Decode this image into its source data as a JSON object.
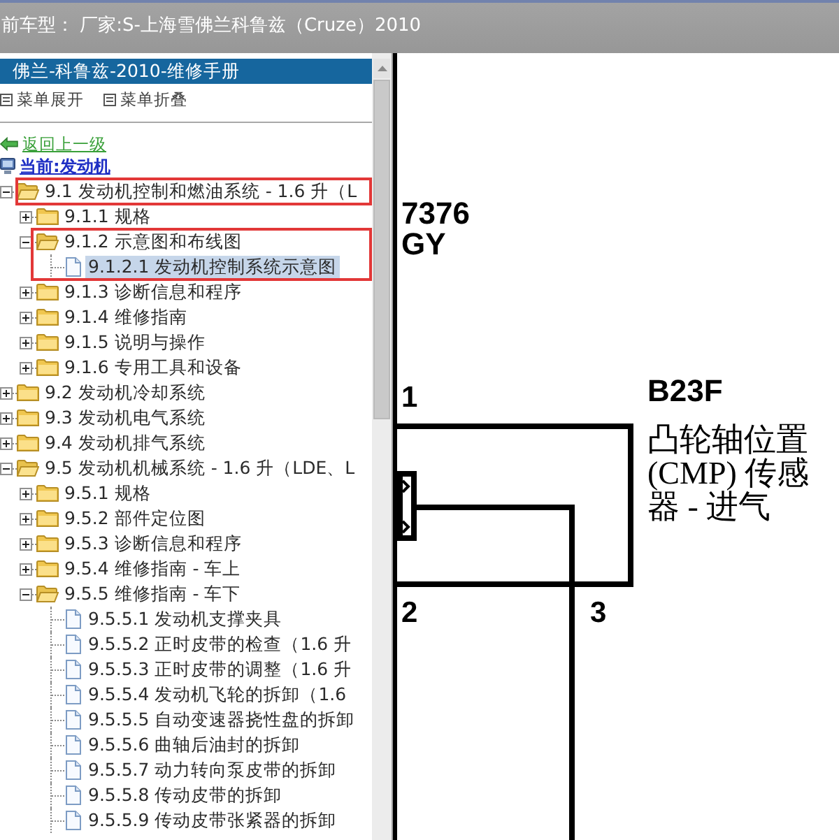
{
  "top_bar": {
    "text": "前车型： 厂家:S-上海雪佛兰科鲁兹（Cruze）2010"
  },
  "manual_panel": {
    "title": "佛兰-科鲁兹-2010-维修手册",
    "toolbar": [
      {
        "label": "菜单展开"
      },
      {
        "label": "菜单折叠"
      }
    ],
    "back_link": "返回上一级",
    "current_location": "当前:发动机",
    "tree": [
      {
        "kind": "folder",
        "label": "9.1 发动机控制和燃油系统 - 1.6 升（L",
        "expanded": true,
        "selected": false,
        "highlighted": true,
        "children": [
          {
            "kind": "folder",
            "label": "9.1.1 规格",
            "expanded": false,
            "selected": false,
            "highlighted": false
          },
          {
            "kind": "folder",
            "label": "9.1.2 示意图和布线图",
            "expanded": true,
            "selected": false,
            "highlighted": true,
            "children": [
              {
                "kind": "page",
                "label": "9.1.2.1 发动机控制系统示意图",
                "selected": true,
                "highlighted": true
              }
            ]
          },
          {
            "kind": "folder",
            "label": "9.1.3 诊断信息和程序",
            "expanded": false,
            "selected": false,
            "highlighted": false
          },
          {
            "kind": "folder",
            "label": "9.1.4 维修指南",
            "expanded": false,
            "selected": false,
            "highlighted": false
          },
          {
            "kind": "folder",
            "label": "9.1.5 说明与操作",
            "expanded": false,
            "selected": false,
            "highlighted": false
          },
          {
            "kind": "folder",
            "label": "9.1.6 专用工具和设备",
            "expanded": false,
            "selected": false,
            "highlighted": false
          }
        ]
      },
      {
        "kind": "folder",
        "label": "9.2 发动机冷却系统",
        "expanded": false,
        "selected": false,
        "highlighted": false
      },
      {
        "kind": "folder",
        "label": "9.3 发动机电气系统",
        "expanded": false,
        "selected": false,
        "highlighted": false
      },
      {
        "kind": "folder",
        "label": "9.4 发动机排气系统",
        "expanded": false,
        "selected": false,
        "highlighted": false
      },
      {
        "kind": "folder",
        "label": "9.5 发动机机械系统 - 1.6 升（LDE、L",
        "expanded": true,
        "selected": false,
        "highlighted": false,
        "children": [
          {
            "kind": "folder",
            "label": "9.5.1 规格",
            "expanded": false,
            "selected": false,
            "highlighted": false
          },
          {
            "kind": "folder",
            "label": "9.5.2 部件定位图",
            "expanded": false,
            "selected": false,
            "highlighted": false
          },
          {
            "kind": "folder",
            "label": "9.5.3 诊断信息和程序",
            "expanded": false,
            "selected": false,
            "highlighted": false
          },
          {
            "kind": "folder",
            "label": "9.5.4 维修指南 - 车上",
            "expanded": false,
            "selected": false,
            "highlighted": false
          },
          {
            "kind": "folder",
            "label": "9.5.5 维修指南 - 车下",
            "expanded": true,
            "selected": false,
            "highlighted": false,
            "children": [
              {
                "kind": "page",
                "label": "9.5.5.1 发动机支撑夹具",
                "selected": false,
                "highlighted": false
              },
              {
                "kind": "page",
                "label": "9.5.5.2 正时皮带的检查（1.6 升",
                "selected": false,
                "highlighted": false
              },
              {
                "kind": "page",
                "label": "9.5.5.3 正时皮带的调整（1.6 升",
                "selected": false,
                "highlighted": false
              },
              {
                "kind": "page",
                "label": "9.5.5.4 发动机飞轮的拆卸（1.6",
                "selected": false,
                "highlighted": false
              },
              {
                "kind": "page",
                "label": "9.5.5.5 自动变速器挠性盘的拆卸",
                "selected": false,
                "highlighted": false
              },
              {
                "kind": "page",
                "label": "9.5.5.6 曲轴后油封的拆卸",
                "selected": false,
                "highlighted": false
              },
              {
                "kind": "page",
                "label": "9.5.5.7 动力转向泵皮带的拆卸",
                "selected": false,
                "highlighted": false
              },
              {
                "kind": "page",
                "label": "9.5.5.8 传动皮带的拆卸",
                "selected": false,
                "highlighted": false
              },
              {
                "kind": "page",
                "label": "9.5.5.9 传动皮带张紧器的拆卸",
                "selected": false,
                "highlighted": false
              }
            ]
          }
        ]
      }
    ]
  },
  "diagram": {
    "wire_number": "7376",
    "wire_color_code": "GY",
    "component_id": "B23F",
    "component_name": "凸轮轴位置(CMP) 传感器 - 进气",
    "pins": [
      "1",
      "2",
      "3"
    ]
  }
}
